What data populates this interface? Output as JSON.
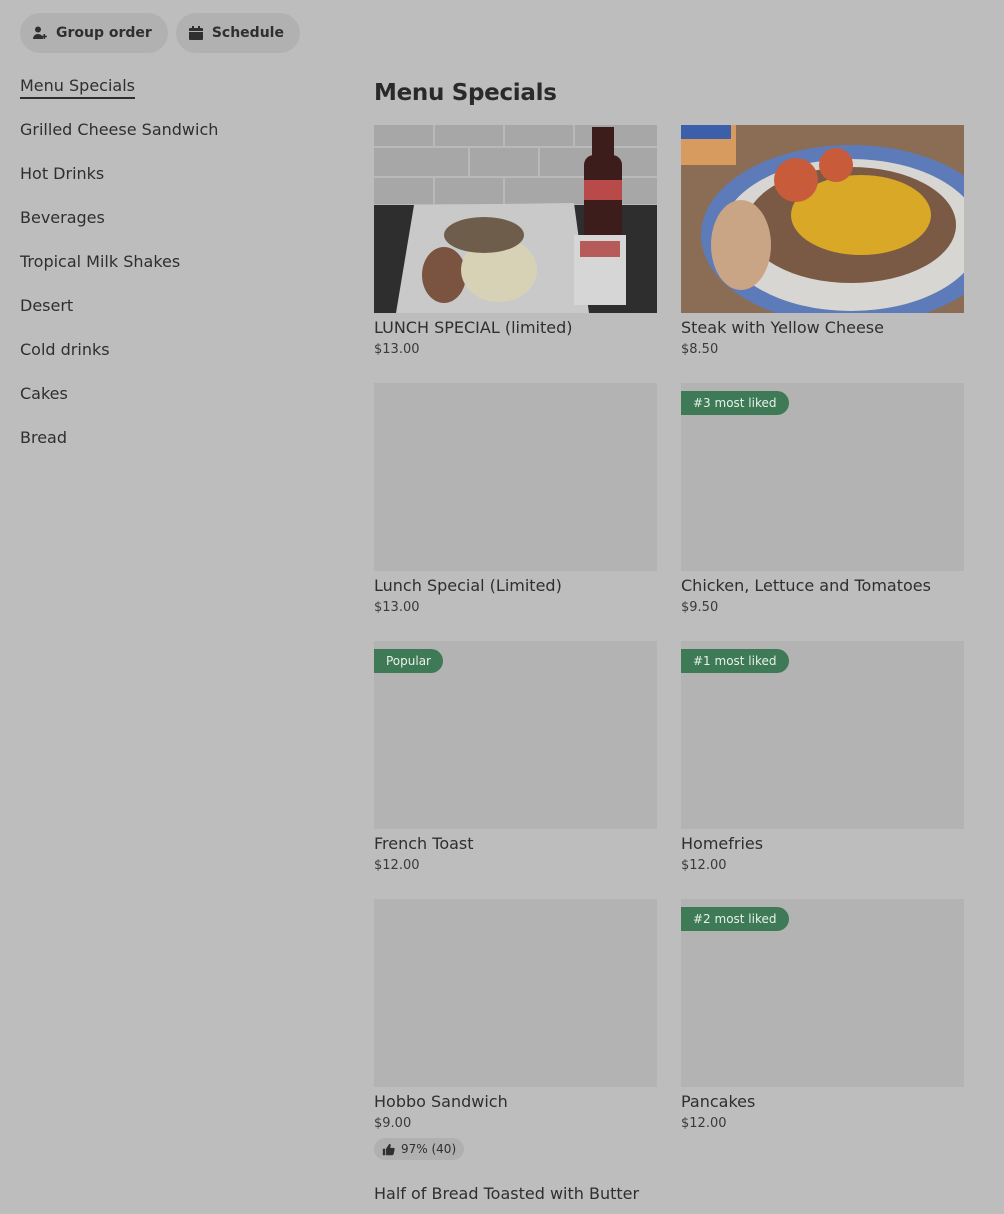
{
  "topbar": {
    "group_order": "Group order",
    "schedule": "Schedule"
  },
  "sidebar": {
    "items": [
      {
        "label": "Menu Specials"
      },
      {
        "label": "Grilled Cheese Sandwich"
      },
      {
        "label": "Hot Drinks"
      },
      {
        "label": "Beverages"
      },
      {
        "label": "Tropical Milk Shakes"
      },
      {
        "label": "Desert"
      },
      {
        "label": "Cold drinks"
      },
      {
        "label": "Cakes"
      },
      {
        "label": "Bread"
      }
    ]
  },
  "main": {
    "title": "Menu Specials",
    "items": [
      {
        "name": "LUNCH SPECIAL (limited)",
        "price": "$13.00"
      },
      {
        "name": "Steak with Yellow Cheese",
        "price": "$8.50"
      },
      {
        "name": "Lunch Special (Limited)",
        "price": "$13.00"
      },
      {
        "name": "Chicken, Lettuce and Tomatoes",
        "price": "$9.50",
        "badge": "#3 most liked"
      },
      {
        "name": "French Toast",
        "price": "$12.00",
        "badge": "Popular"
      },
      {
        "name": "Homefries",
        "price": "$12.00",
        "badge": "#1 most liked"
      },
      {
        "name": "Hobbo Sandwich",
        "price": "$9.00",
        "rating": "97% (40)"
      },
      {
        "name": "Pancakes",
        "price": "$12.00",
        "badge": "#2 most liked"
      },
      {
        "name": "Half of Bread Toasted with Butter"
      }
    ]
  },
  "colors": {
    "background": "#bdbdbd",
    "badge": "#3e7a56",
    "placeholder": "#b3b3b3"
  }
}
